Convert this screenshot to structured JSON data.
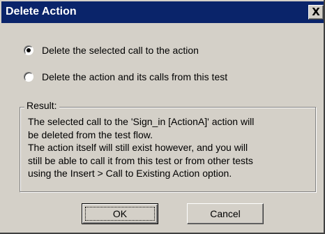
{
  "window": {
    "title": "Delete Action",
    "close_label": "X"
  },
  "options": {
    "items": [
      {
        "label": "Delete the selected call to the action",
        "checked": true
      },
      {
        "label": "Delete the action and its calls from this test",
        "checked": false
      }
    ]
  },
  "result": {
    "legend": "Result:",
    "lines": [
      "The selected call to the 'Sign_in [ActionA]' action will",
      "be deleted from the test flow.",
      "The action itself will still exist however, and you will",
      "still be able to call it from this test or from other tests",
      "using the Insert > Call to Existing Action option."
    ]
  },
  "buttons": {
    "ok_label": "OK",
    "cancel_label": "Cancel"
  },
  "colors": {
    "titlebar": "#0a246a",
    "face": "#d4d0c8"
  }
}
